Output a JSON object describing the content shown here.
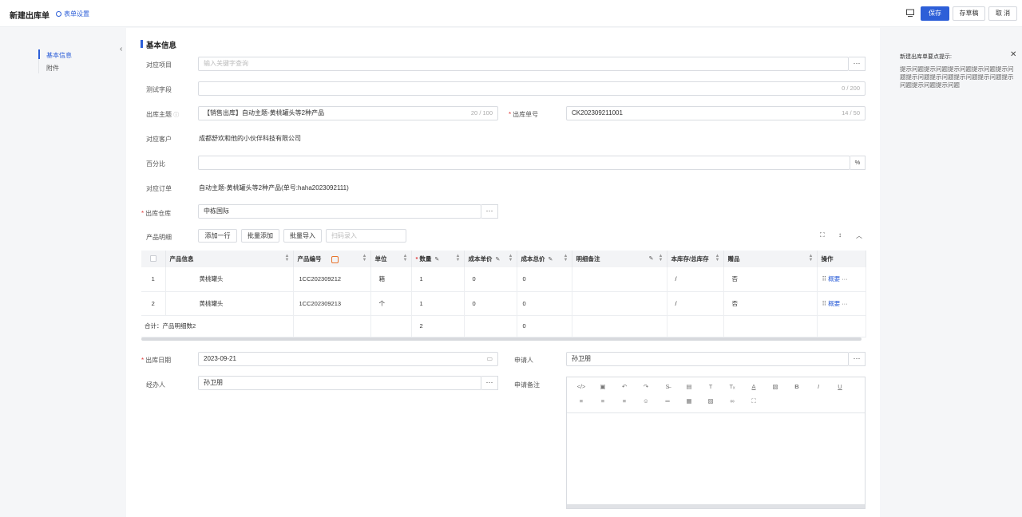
{
  "header": {
    "title": "新建出库单",
    "form_settings": "表单设置",
    "save": "保存",
    "draft": "存草稿",
    "cancel": "取 消"
  },
  "nav": {
    "items": [
      "基本信息",
      "附件"
    ]
  },
  "section_title": "基本信息",
  "fields": {
    "project": {
      "label": "对应项目",
      "placeholder": "输入关键字查询"
    },
    "test": {
      "label": "测试字段",
      "count": "0 / 200"
    },
    "subject": {
      "label": "出库主题",
      "value": "【销售出库】自动主题-黄桃罐头等2种产品",
      "count": "20 / 100"
    },
    "order_no": {
      "label": "出库单号",
      "value": "CK202309211001",
      "count": "14 / 50"
    },
    "customer": {
      "label": "对应客户",
      "value": "成都舒欢和他的小伙伴科技有限公司"
    },
    "percent": {
      "label": "百分比",
      "suffix": "%"
    },
    "order": {
      "label": "对应订单",
      "value": "自动主题-黄桃罐头等2种产品(单号:haha2023092111)"
    },
    "warehouse": {
      "label": "出库仓库",
      "value": "中栋国际"
    },
    "products_label": "产品明细",
    "date": {
      "label": "出库日期",
      "value": "2023-09-21"
    },
    "applicant": {
      "label": "申请人",
      "value": "孙卫朋"
    },
    "handler": {
      "label": "经办人",
      "value": "孙卫朋"
    },
    "remark": {
      "label": "申请备注"
    }
  },
  "product_toolbar": {
    "add_row": "添加一行",
    "batch_add": "批量添加",
    "batch_import": "批量导入",
    "scan_placeholder": "扫码录入"
  },
  "table": {
    "headers": [
      "产品信息",
      "产品编号",
      "单位",
      "数量",
      "成本单价",
      "成本总价",
      "明细备注",
      "本库存/总库存",
      "赠品",
      "操作"
    ],
    "rows": [
      {
        "idx": "1",
        "name": "黄桃罐头",
        "code": "1CC202309212",
        "unit": "箱",
        "qty": "1",
        "price": "0",
        "total": "0",
        "note": "",
        "stock": "/",
        "gift": "否",
        "op": "概要"
      },
      {
        "idx": "2",
        "name": "黄桃罐头",
        "code": "1CC202309213",
        "unit": "个",
        "qty": "1",
        "price": "0",
        "total": "0",
        "note": "",
        "stock": "/",
        "gift": "否",
        "op": "概要"
      }
    ],
    "summary": {
      "label": "合计：产品明细数2",
      "qty": "2",
      "total": "0"
    }
  },
  "tips": {
    "title": "新建出库单要点提示:",
    "text": "提示问题提示问题提示问题提示问题提示问题提示问题提示问题提示问题提示问题提示问题提示问题提示问题"
  }
}
